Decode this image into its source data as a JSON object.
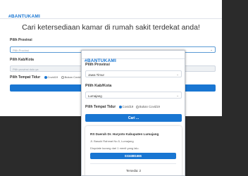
{
  "brand": "#BANTUKAMI",
  "desktop": {
    "headline": "Cari ketersediaan kamar di rumah sakit terdekat anda!",
    "province_label": "Pilih Provinsi",
    "province_placeholder": "Pilih Provinsi",
    "city_label": "Pilih Kab/Kota",
    "city_placeholder": "Pilih provinsi dulu ya",
    "bed_label": "Pilih Tempat Tidur",
    "option_covid": "Covid19",
    "option_noncovid": "Bukan Covid19"
  },
  "mobile": {
    "brand": "#BANTUKAMI",
    "province_label": "Pilih Provinsi",
    "province_value": "Jawa Timur",
    "city_label": "Pilih Kab/Kota",
    "city_value": "Lumajang",
    "bed_label": "Pilih Tempat Tidur",
    "option_covid": "Covid19",
    "option_noncovid": "Bukan Covid19",
    "search_label": "Cari ...",
    "result": {
      "name": "RS Daerah Dr. Haryoto Kabupaten Lumajang",
      "address": "Jl. Basuki Rahmat No.5, Lumajang",
      "status": "Diupdate kurang dari 1 menit yang lalu.",
      "phone": "0334881666",
      "availability": "Tersedia: 2"
    }
  },
  "colors": {
    "accent": "#1976d2",
    "backdrop": "#2b2b2b"
  }
}
